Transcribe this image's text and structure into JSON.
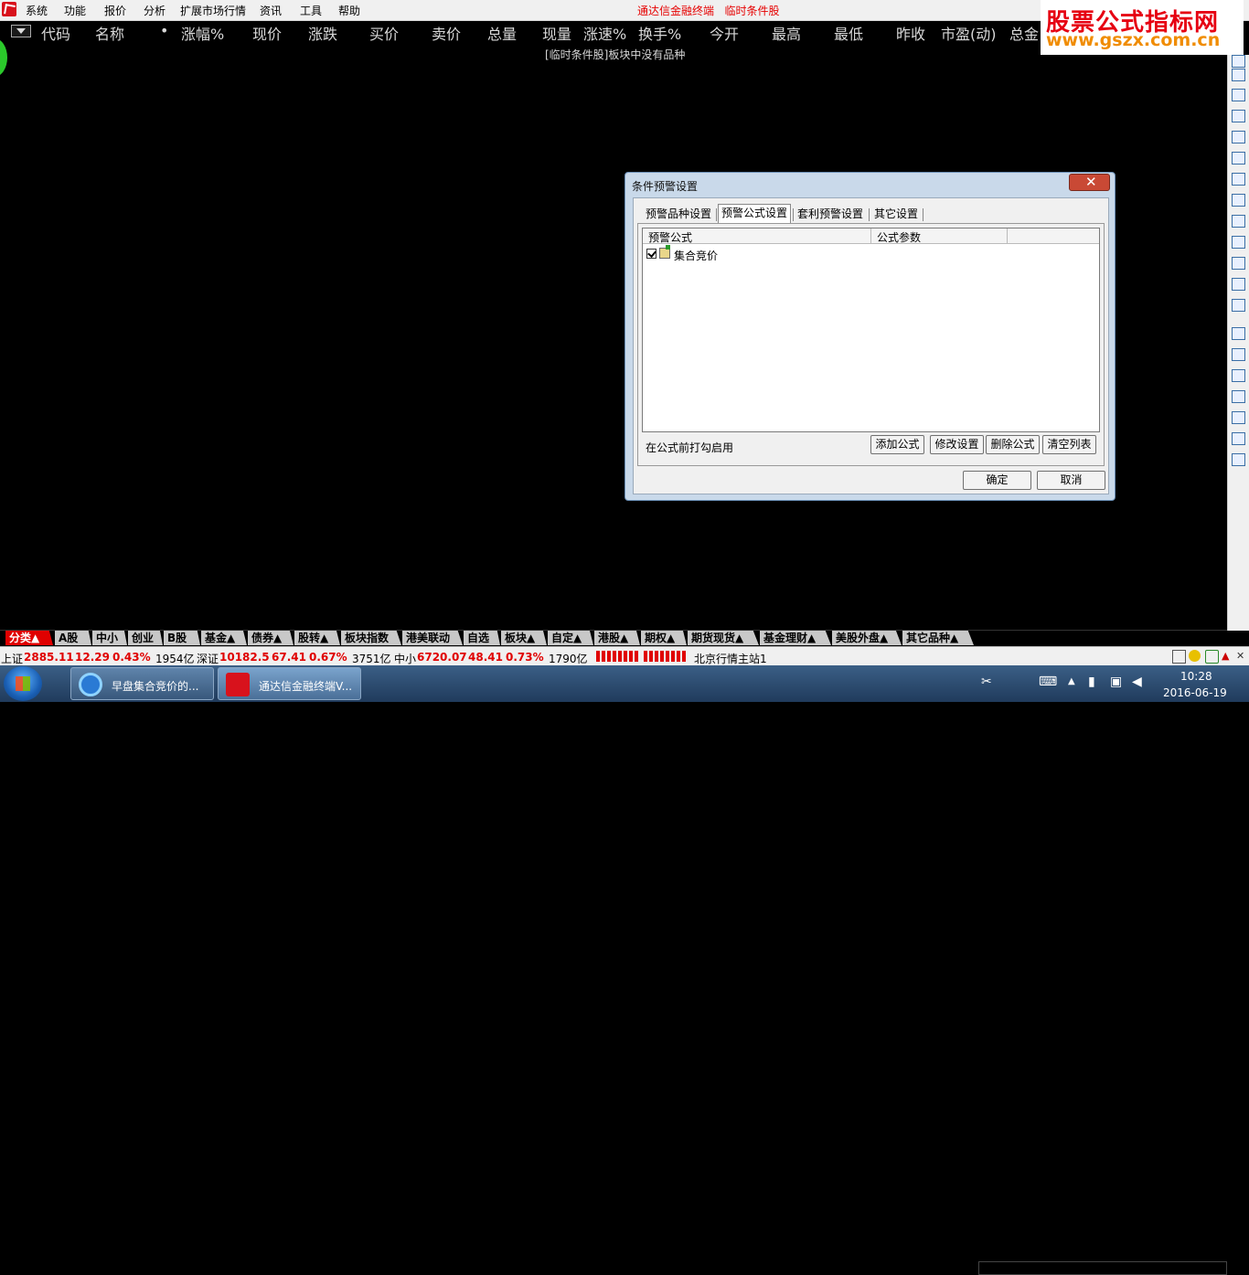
{
  "menubar": {
    "items": [
      "系统",
      "功能",
      "报价",
      "分析",
      "扩展市场行情",
      "资讯",
      "工具",
      "帮助"
    ],
    "title": "通达信金融终端",
    "subtitle": "临时条件股"
  },
  "watermark": {
    "title": "股票公式指标网",
    "url": "www.gszx.com.cn"
  },
  "table": {
    "headers": [
      "代码",
      "名称",
      "•",
      "涨幅%",
      "现价",
      "涨跌",
      "买价",
      "卖价",
      "总量",
      "现量",
      "涨速%",
      "换手%",
      "今开",
      "最高",
      "最低",
      "昨收",
      "市盈(动)",
      "总金"
    ],
    "empty_message": "[临时条件股]板块中没有品种"
  },
  "dialog": {
    "title": "条件预警设置",
    "close_symbol": "✕",
    "tabs": [
      "预警品种设置",
      "预警公式设置",
      "套利预警设置",
      "其它设置"
    ],
    "active_tab": 1,
    "list_headers": [
      "预警公式",
      "公式参数"
    ],
    "rows": [
      {
        "checked": true,
        "name": "集合竞价",
        "params": ""
      }
    ],
    "hint": "在公式前打勾启用",
    "buttons": {
      "add": "添加公式",
      "modify": "修改设置",
      "delete": "删除公式",
      "clear": "清空列表",
      "ok": "确定",
      "cancel": "取消"
    }
  },
  "category_tabs": [
    "分类▲",
    "A股",
    "中小",
    "创业",
    "B股",
    "基金▲",
    "债券▲",
    "股转▲",
    "板块指数",
    "港美联动",
    "自选",
    "板块▲",
    "自定▲",
    "港股▲",
    "期权▲",
    "期货现货▲",
    "基金理财▲",
    "美股外盘▲",
    "其它品种▲"
  ],
  "status": {
    "sh_label": "上证",
    "sh_index": "2885.11",
    "sh_change": "12.29",
    "sh_pct": "0.43%",
    "sh_amount": "1954亿",
    "sz_label": "深证",
    "sz_index": "10182.5",
    "sz_change": "67.41",
    "sz_pct": "0.67%",
    "sz_amount": "3751亿",
    "zx_label": "中小",
    "zx_index": "6720.07",
    "zx_change": "48.41",
    "zx_pct": "0.73%",
    "zx_amount": "1790亿",
    "server": "北京行情主站1"
  },
  "taskbar": {
    "task1": "早盘集合竞价的...",
    "task2": "通达信金融终端V...",
    "time": "10:28",
    "date": "2016-06-19"
  },
  "colors": {
    "accent_red": "#e00000",
    "background": "#000000",
    "dialog_frame": "#c9d9ea"
  }
}
